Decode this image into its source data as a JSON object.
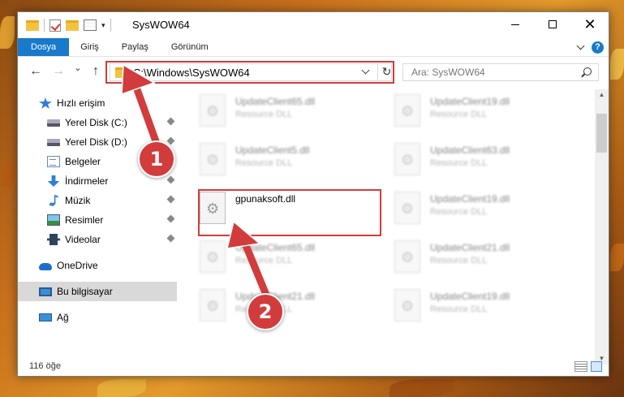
{
  "window": {
    "title": "SysWOW64",
    "min_icon": "minimize-icon",
    "max_icon": "maximize-icon",
    "close_icon": "close-icon"
  },
  "ribbon": {
    "tabs": [
      {
        "label": "Dosya"
      },
      {
        "label": "Giriş"
      },
      {
        "label": "Paylaş"
      },
      {
        "label": "Görünüm"
      }
    ],
    "help": "?"
  },
  "nav": {
    "back": "←",
    "forward": "→",
    "recent": "⌄",
    "up": "↑"
  },
  "address": {
    "path": "C:\\Windows\\SysWOW64",
    "refresh": "↻"
  },
  "search": {
    "placeholder": "Ara: SysWOW64"
  },
  "sidebar": {
    "items": [
      {
        "label": "Hızlı erişim"
      },
      {
        "label": "Yerel Disk (C:)"
      },
      {
        "label": "Yerel Disk (D:)"
      },
      {
        "label": "Belgeler"
      },
      {
        "label": "İndirmeler"
      },
      {
        "label": "Müzik"
      },
      {
        "label": "Resimler"
      },
      {
        "label": "Videolar"
      },
      {
        "label": "OneDrive"
      },
      {
        "label": "Bu bilgisayar"
      },
      {
        "label": "Ağ"
      }
    ]
  },
  "files": [
    {
      "name": "UpdateClient65.dll",
      "type": "Resource DLL"
    },
    {
      "name": "UpdateClient19.dll",
      "type": "Resource DLL"
    },
    {
      "name": "UpdateClient5.dll",
      "type": "Resource DLL"
    },
    {
      "name": "UpdateClient63.dll",
      "type": "Resource DLL"
    },
    {
      "name": "gpunaksoft.dll",
      "type": ""
    },
    {
      "name": "UpdateClient19.dll",
      "type": "Resource DLL"
    },
    {
      "name": "UpdateClient65.dll",
      "type": "Resource DLL"
    },
    {
      "name": "UpdateClient21.dll",
      "type": "Resource DLL"
    },
    {
      "name": "UpdateClient21.dll",
      "type": "Resource DLL"
    },
    {
      "name": "UpdateClient19.dll",
      "type": "Resource DLL"
    }
  ],
  "status": {
    "count": "116 öğe"
  },
  "annotations": {
    "step1": "1",
    "step2": "2",
    "color": "#d23c3c"
  },
  "colors": {
    "accent": "#1979ca",
    "highlight": "#d23c3c"
  }
}
